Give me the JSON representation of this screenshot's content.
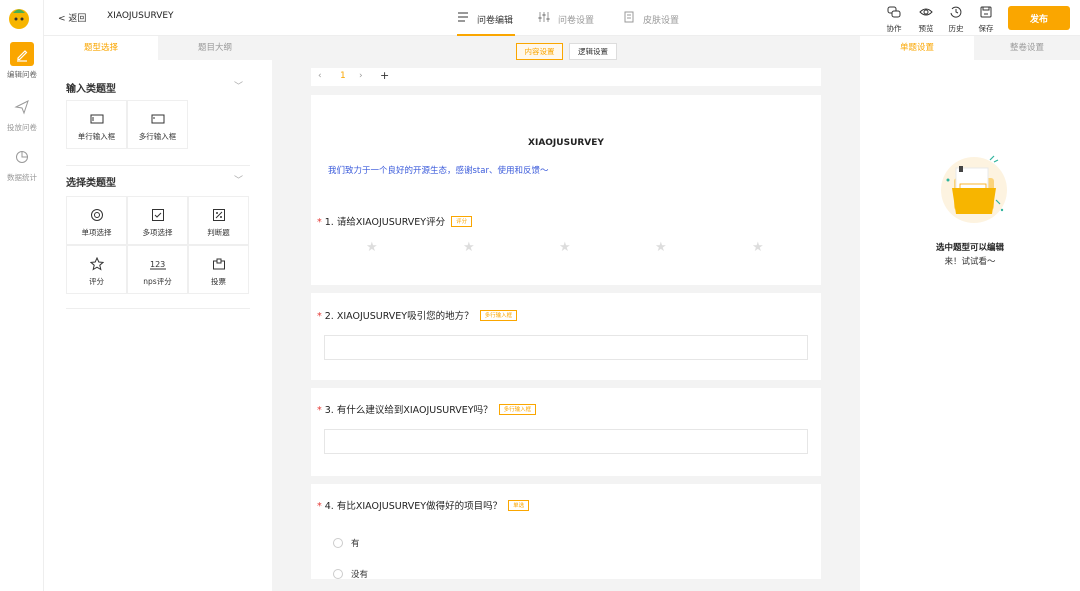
{
  "rail": {
    "items": [
      {
        "label": "编辑问卷",
        "icon": "pencil-icon"
      },
      {
        "label": "投放问卷",
        "icon": "send-icon"
      },
      {
        "label": "数据统计",
        "icon": "pie-chart-icon"
      }
    ]
  },
  "topbar": {
    "back_label": "返回",
    "survey_name": "XIAOJUSURVEY",
    "tabs": [
      {
        "label": "问卷编辑",
        "icon": "edit-list-icon",
        "active": true
      },
      {
        "label": "问卷设置",
        "icon": "sliders-icon",
        "active": false
      },
      {
        "label": "皮肤设置",
        "icon": "document-icon",
        "active": false
      }
    ],
    "tools": [
      {
        "label": "协作",
        "icon": "collaborate-icon"
      },
      {
        "label": "预览",
        "icon": "eye-icon"
      },
      {
        "label": "历史",
        "icon": "history-icon"
      },
      {
        "label": "保存",
        "icon": "save-icon"
      }
    ],
    "publish_label": "发布"
  },
  "left_panel": {
    "tabs": [
      {
        "label": "题型选择"
      },
      {
        "label": "题目大纲"
      }
    ],
    "groups": [
      {
        "title": "输入类题型",
        "items": [
          {
            "label": "单行输入框",
            "icon": "single-line-input-icon"
          },
          {
            "label": "多行输入框",
            "icon": "multi-line-input-icon"
          }
        ]
      },
      {
        "title": "选择类题型",
        "items": [
          {
            "label": "单项选择",
            "icon": "radio-icon"
          },
          {
            "label": "多项选择",
            "icon": "checkbox-icon"
          },
          {
            "label": "判断题",
            "icon": "judge-icon"
          },
          {
            "label": "评分",
            "icon": "star-icon"
          },
          {
            "label": "nps评分",
            "icon": "nps-icon"
          },
          {
            "label": "投票",
            "icon": "vote-icon"
          }
        ]
      }
    ]
  },
  "canvas": {
    "tabs": [
      {
        "label": "内容设置"
      },
      {
        "label": "逻辑设置"
      }
    ],
    "pager": {
      "prev": "‹",
      "page": "1",
      "next": "›",
      "add": "+"
    },
    "survey_title": "XIAOJUSURVEY",
    "survey_desc": "我们致力于一个良好的开源生态，感谢star、使用和反馈～",
    "questions": [
      {
        "required": "*",
        "title": "1. 请给XIAOJUSURVEY评分",
        "tag": "评分"
      },
      {
        "required": "*",
        "title": "2. XIAOJUSURVEY吸引您的地方？",
        "tag": "多行输入框"
      },
      {
        "required": "*",
        "title": "3. 有什么建议给到XIAOJUSURVEY吗？",
        "tag": "多行输入框"
      },
      {
        "required": "*",
        "title": "4. 有比XIAOJUSURVEY做得好的项目吗？",
        "tag": "单选",
        "options": [
          "有",
          "没有"
        ]
      }
    ]
  },
  "right_panel": {
    "tabs": [
      {
        "label": "单题设置"
      },
      {
        "label": "整卷设置"
      }
    ],
    "empty_title": "选中题型可以编辑",
    "empty_sub": "来！试试看～"
  },
  "colors": {
    "accent": "#faa600",
    "link": "#3b5bdb",
    "required": "#e53935"
  }
}
